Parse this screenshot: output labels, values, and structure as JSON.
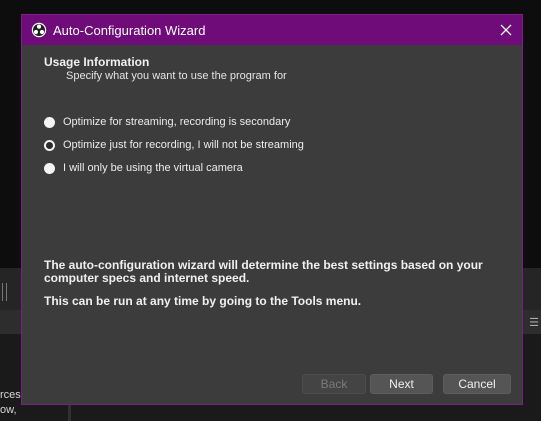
{
  "window": {
    "title": "Auto-Configuration Wizard",
    "title_bar_color": "#6f0c7a",
    "background_color": "#3c3c3c"
  },
  "section": {
    "heading": "Usage Information",
    "subheading": "Specify what you want to use the program for"
  },
  "options": [
    {
      "label": "Optimize for streaming, recording is secondary",
      "selected": false
    },
    {
      "label": "Optimize just for recording, I will not be streaming",
      "selected": true
    },
    {
      "label": "I will only be using the virtual camera",
      "selected": false
    }
  ],
  "info": {
    "line1": "The auto-configuration wizard will determine the best settings based on your computer specs and internet speed.",
    "line2": "This can be run at any time by going to the Tools menu."
  },
  "buttons": {
    "back": "Back",
    "next": "Next",
    "cancel": "Cancel"
  },
  "background_app": {
    "text1": "rces.",
    "text2": "ow,"
  }
}
